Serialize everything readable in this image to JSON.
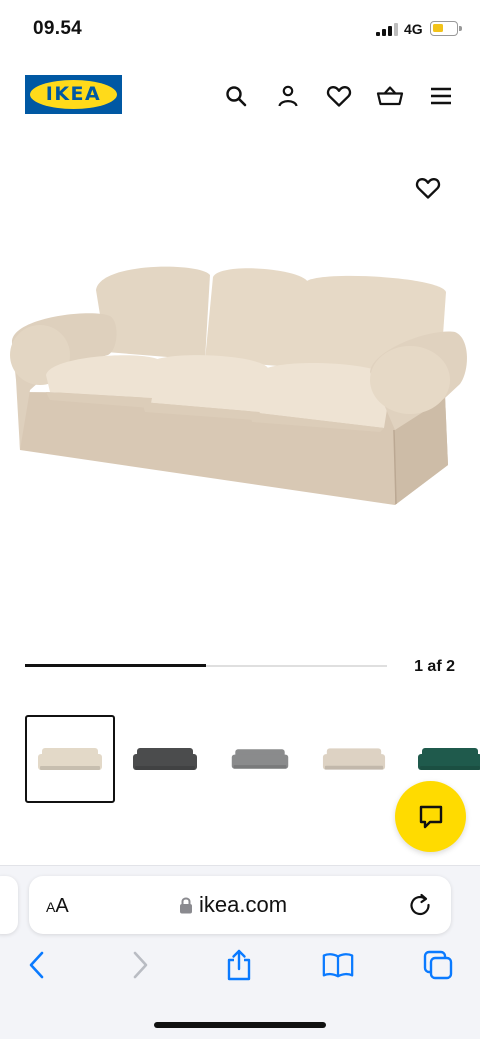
{
  "status_bar": {
    "time": "09.54",
    "network": "4G",
    "battery_level": 0.45,
    "battery_color": "#f2c31a"
  },
  "header": {
    "logo_text": "IKEA",
    "brand_blue": "#0058a3",
    "brand_yellow": "#ffda1a",
    "icons": [
      "search-icon",
      "account-icon",
      "heart-icon",
      "basket-icon",
      "menu-icon"
    ]
  },
  "gallery": {
    "main_image": "sofa-beige",
    "favorite_icon": "heart-icon",
    "pager_label": "1 af 2",
    "pager_progress": 0.5
  },
  "thumbnails": [
    {
      "color_name": "beige",
      "color": "#e3d9c8",
      "selected": true
    },
    {
      "color_name": "dark-grey",
      "color": "#4b4c4d",
      "selected": false
    },
    {
      "color_name": "grey",
      "color": "#8a8b8c",
      "selected": false
    },
    {
      "color_name": "beige-alt",
      "color": "#ddd2c3",
      "selected": false
    },
    {
      "color_name": "dark-green",
      "color": "#1f5a4c",
      "selected": false
    }
  ],
  "chat": {
    "icon": "chat-icon",
    "color": "#ffdb00"
  },
  "browser": {
    "aa_label_small": "A",
    "aa_label_large": "A",
    "url": "ikea.com",
    "accent": "#0a7aff",
    "toolbar_icons": [
      "back-icon",
      "forward-icon",
      "share-icon",
      "bookmarks-icon",
      "tabs-icon"
    ]
  }
}
